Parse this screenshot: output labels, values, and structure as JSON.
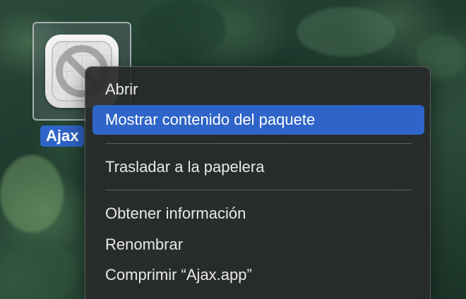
{
  "desktop": {
    "file": {
      "name": "Ajax",
      "icon": "prohibited-app-icon"
    }
  },
  "context_menu": {
    "items": [
      {
        "label": "Abrir"
      },
      {
        "label": "Mostrar contenido del paquete",
        "highlighted": true
      },
      {
        "label": "Trasladar a la papelera"
      },
      {
        "label": "Obtener información"
      },
      {
        "label": "Renombrar"
      },
      {
        "label": "Comprimir “Ajax.app”"
      }
    ]
  },
  "colors": {
    "highlight": "#2f64c8",
    "menu_background": "#282a2a",
    "menu_text": "#e9e9e9"
  }
}
